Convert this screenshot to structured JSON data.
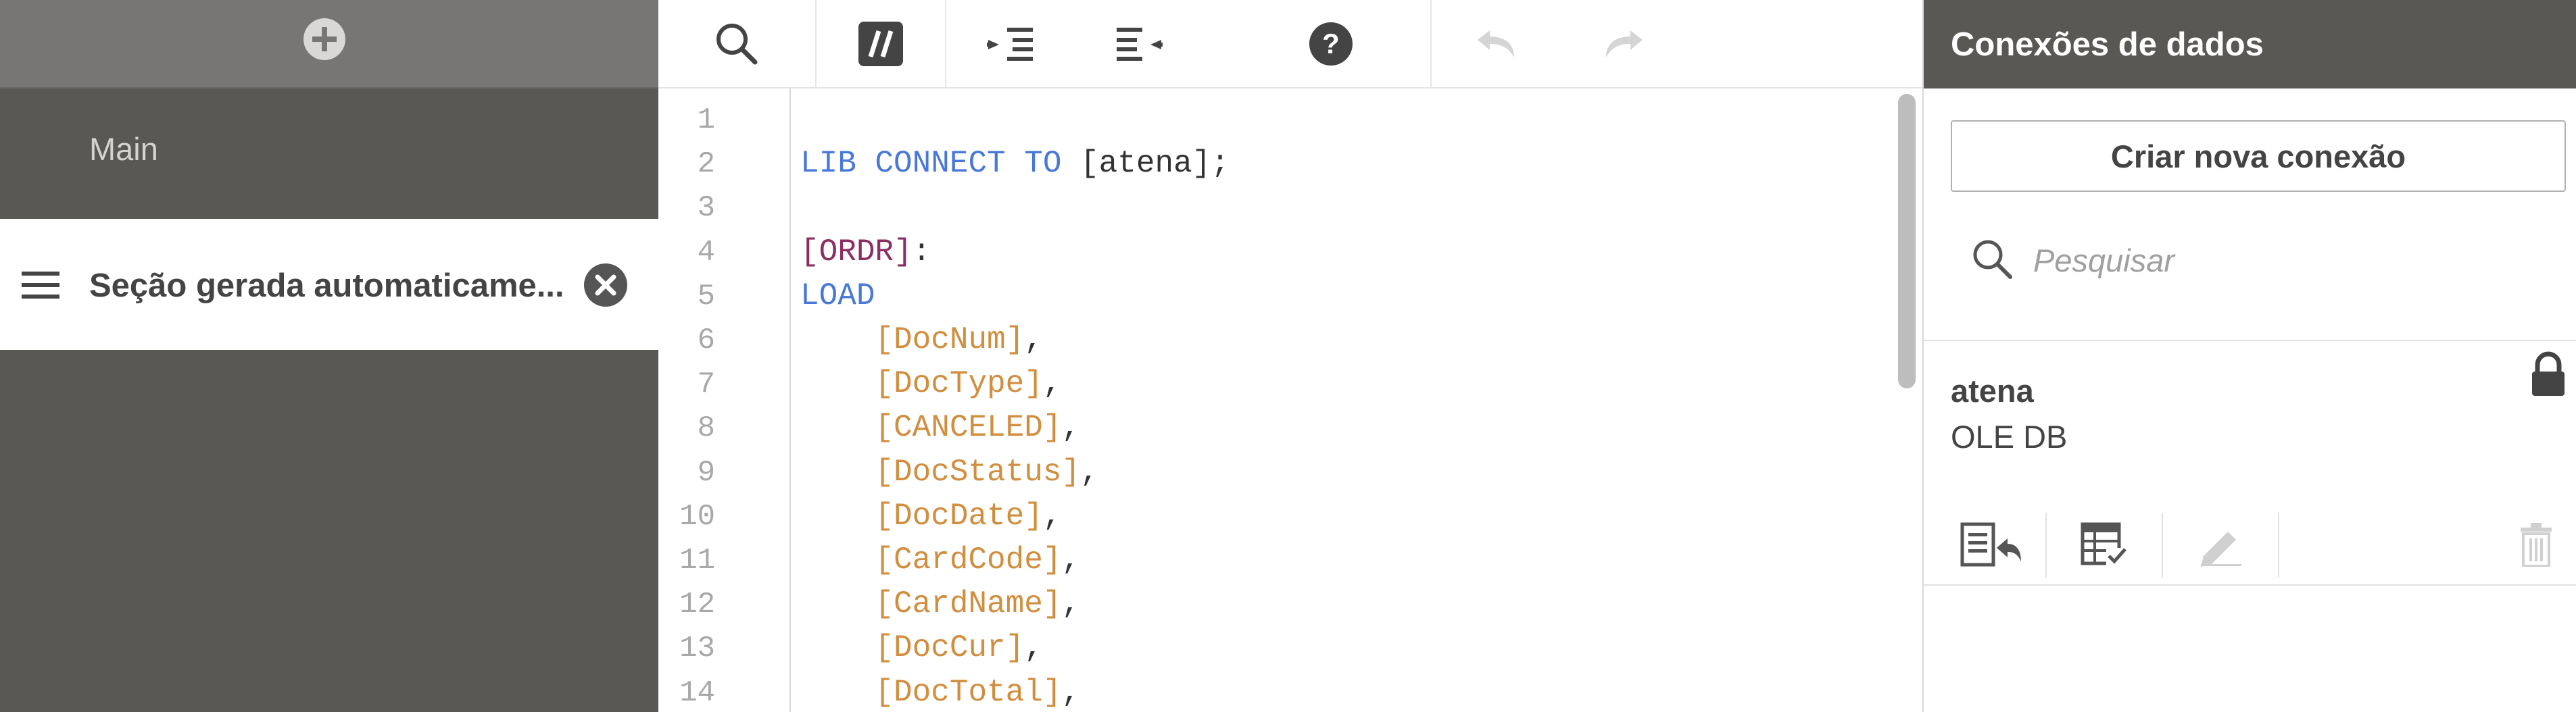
{
  "sidebar": {
    "add_icon": "plus-circle-icon",
    "sections": [
      {
        "label": "Main",
        "active": false
      },
      {
        "label": "Seção gerada automaticame...",
        "active": true
      }
    ]
  },
  "toolbar": {
    "buttons": [
      {
        "name": "search",
        "icon": "search-icon"
      },
      {
        "name": "comment",
        "icon": "comment-toggle-icon"
      },
      {
        "name": "indent",
        "icon": "indent-icon"
      },
      {
        "name": "outdent",
        "icon": "outdent-icon"
      },
      {
        "name": "help",
        "icon": "help-icon"
      },
      {
        "name": "undo",
        "icon": "undo-icon",
        "enabled": false
      },
      {
        "name": "redo",
        "icon": "redo-icon",
        "enabled": false
      }
    ]
  },
  "editor": {
    "lines": [
      {
        "n": "1",
        "tokens": []
      },
      {
        "n": "2",
        "tokens": [
          [
            "kw",
            "LIB CONNECT TO"
          ],
          [
            "txt",
            " [atena];"
          ]
        ]
      },
      {
        "n": "3",
        "tokens": []
      },
      {
        "n": "4",
        "tokens": [
          [
            "tbl",
            "[ORDR]"
          ],
          [
            "txt",
            ":"
          ]
        ]
      },
      {
        "n": "5",
        "tokens": [
          [
            "kw",
            "LOAD"
          ]
        ]
      },
      {
        "n": "6",
        "tokens": [
          [
            "txt",
            "    "
          ],
          [
            "fld",
            "[DocNum]"
          ],
          [
            "txt",
            ","
          ]
        ]
      },
      {
        "n": "7",
        "tokens": [
          [
            "txt",
            "    "
          ],
          [
            "fld",
            "[DocType]"
          ],
          [
            "txt",
            ","
          ]
        ]
      },
      {
        "n": "8",
        "tokens": [
          [
            "txt",
            "    "
          ],
          [
            "fld",
            "[CANCELED]"
          ],
          [
            "txt",
            ","
          ]
        ]
      },
      {
        "n": "9",
        "tokens": [
          [
            "txt",
            "    "
          ],
          [
            "fld",
            "[DocStatus]"
          ],
          [
            "txt",
            ","
          ]
        ]
      },
      {
        "n": "10",
        "tokens": [
          [
            "txt",
            "    "
          ],
          [
            "fld",
            "[DocDate]"
          ],
          [
            "txt",
            ","
          ]
        ]
      },
      {
        "n": "11",
        "tokens": [
          [
            "txt",
            "    "
          ],
          [
            "fld",
            "[CardCode]"
          ],
          [
            "txt",
            ","
          ]
        ]
      },
      {
        "n": "12",
        "tokens": [
          [
            "txt",
            "    "
          ],
          [
            "fld",
            "[CardName]"
          ],
          [
            "txt",
            ","
          ]
        ]
      },
      {
        "n": "13",
        "tokens": [
          [
            "txt",
            "    "
          ],
          [
            "fld",
            "[DocCur]"
          ],
          [
            "txt",
            ","
          ]
        ]
      },
      {
        "n": "14",
        "tokens": [
          [
            "txt",
            "    "
          ],
          [
            "fld",
            "[DocTotal]"
          ],
          [
            "txt",
            ","
          ]
        ]
      }
    ]
  },
  "panel": {
    "title": "Conexões de dados",
    "new_connection_label": "Criar nova conexão",
    "search_placeholder": "Pesquisar",
    "connections": [
      {
        "name": "atena",
        "type": "OLE DB",
        "locked": true,
        "actions": [
          "insert-connect-string-icon",
          "select-data-icon",
          "edit-icon",
          "delete-icon"
        ]
      }
    ]
  },
  "colors": {
    "sidebar_bg": "#595855",
    "keyword": "#4a78d6",
    "table": "#8b2f63",
    "field": "#d18e3f"
  }
}
